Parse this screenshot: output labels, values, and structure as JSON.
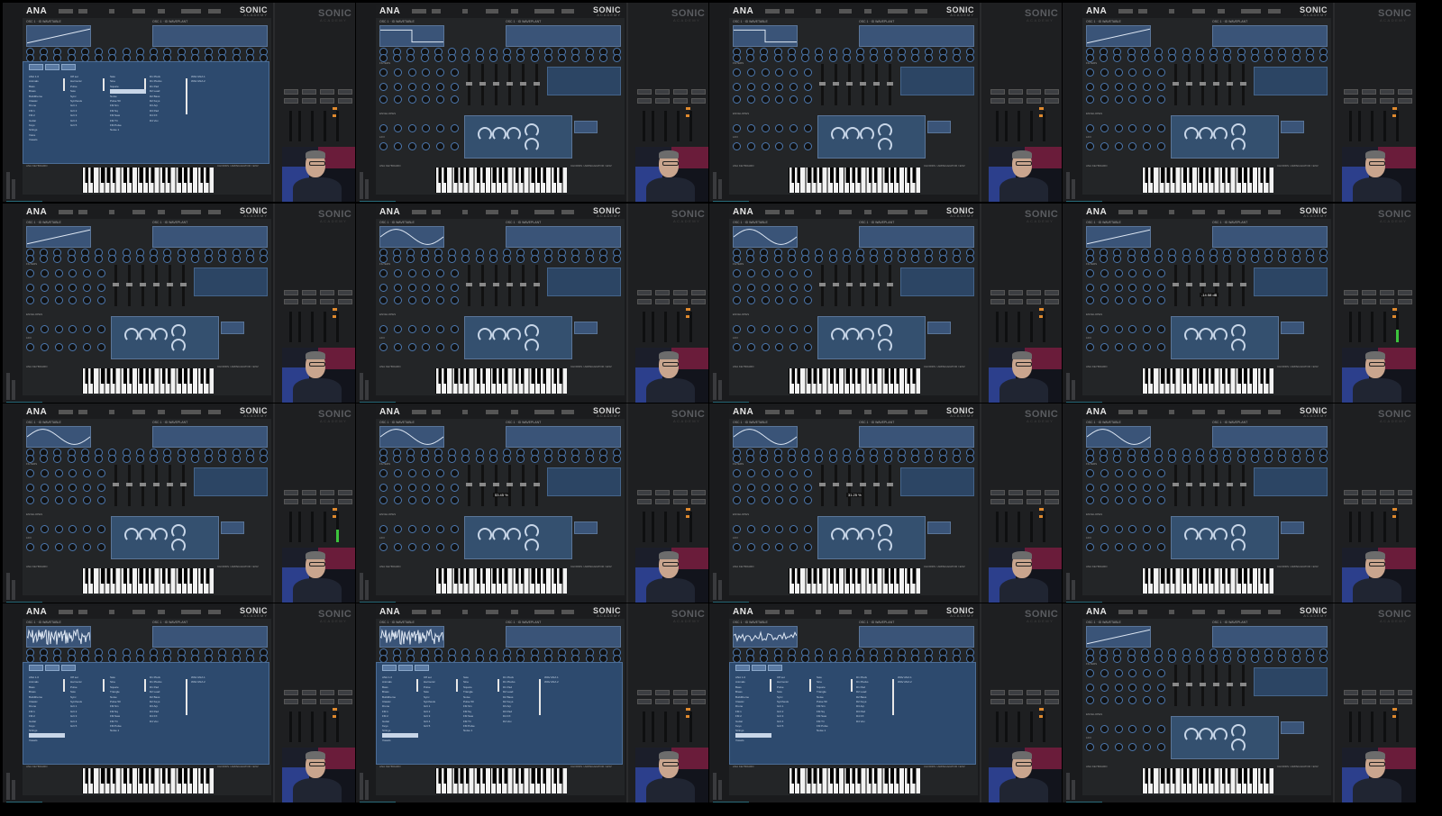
{
  "frames": [
    {
      "view": "browser",
      "wave": "saw"
    },
    {
      "view": "main",
      "wave": "square"
    },
    {
      "view": "main",
      "wave": "square"
    },
    {
      "view": "main",
      "wave": "saw"
    },
    {
      "view": "main",
      "wave": "saw"
    },
    {
      "view": "main",
      "wave": "sine"
    },
    {
      "view": "main",
      "wave": "sine"
    },
    {
      "view": "main",
      "wave": "saw",
      "tooltip": "-14.58 dB"
    },
    {
      "view": "main",
      "wave": "sine"
    },
    {
      "view": "main",
      "wave": "sine",
      "tooltip": "53.45 %"
    },
    {
      "view": "main",
      "wave": "sine",
      "tooltip": "31.25 %"
    },
    {
      "view": "main",
      "wave": "sine"
    },
    {
      "view": "browser",
      "wave": "noise"
    },
    {
      "view": "browser",
      "wave": "noise"
    },
    {
      "view": "browser",
      "wave": "sparse"
    },
    {
      "view": "main",
      "wave": "saw"
    }
  ],
  "synth": {
    "name": "ANA",
    "brand": "SONIC",
    "brand_sub": "ACADEMY",
    "osc1_label": "OSC 1 · ID WAVETABLE",
    "osc2_label": "OSC 1 · ID WAVEPLANT",
    "filters_label": "FILTERS",
    "envelopes_label": "ENVELOPES",
    "lfo_label": "LFO",
    "keyboard_label": "ANA KEYBOARD",
    "chords_label": "CHORDS / ARPEGGIATOR / ENV",
    "browser_tabs": [
      "OSC 1",
      "OSC 2",
      "OSC 3"
    ],
    "browser_columns": [
      [
        "ANA 1.0",
        "Animals",
        "Bass",
        "Brass",
        "Buildtheme",
        "Classic",
        "Drone",
        "FM 1",
        "FM 2",
        "Guitar",
        "Keys",
        "Strings",
        "Voice",
        "Vowels"
      ],
      [
        "Off set",
        "Harmonic",
        "Pulse",
        "Saw",
        "Sync",
        "Synthesis",
        "Grit 1",
        "Grit 2",
        "Grit 3",
        "Grit 4",
        "Grit 5"
      ],
      [
        "Saw",
        "Sine",
        "Square",
        "Triangle",
        "Noise",
        "Pulse 50",
        "FM Sin",
        "FM Sq",
        "FM Saw",
        "FM Tri",
        "FM Pulse",
        "Noise 1"
      ],
      [
        "D1 Pluck",
        "D1 Plucks",
        "D1 Pad",
        "D2 Lead",
        "D2 Bass",
        "D2 Keys",
        "D3 Arp",
        "D3 Pad",
        "D4 FX",
        "D4 Vox"
      ],
      [
        "WAV ANA 1",
        "WAV ANA 2"
      ]
    ]
  }
}
